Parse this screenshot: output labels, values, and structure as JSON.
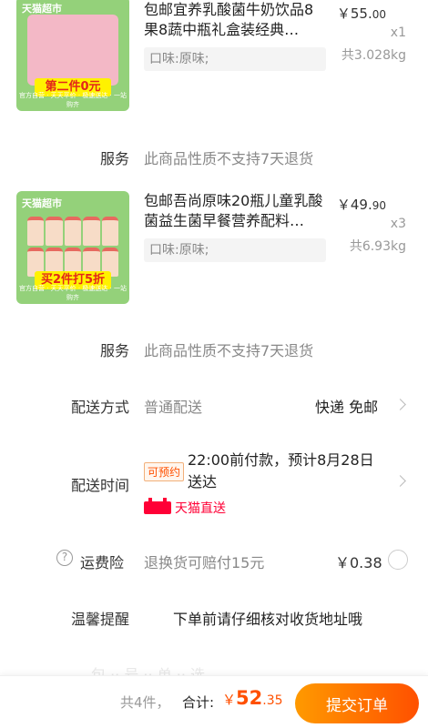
{
  "products": [
    {
      "brand_tag": "天猫超市",
      "promo": "第二件0元",
      "thumb_footer": "官方自营 · 天天平价 · 极速送达 · 一站购齐",
      "title": "包邮宜养乳酸菌牛奶饮品8果8蔬中瓶礼盒装经典…",
      "spec": "口味:原味;",
      "currency": "￥",
      "price_int": "55.",
      "price_dec": "00",
      "qty": "x1",
      "weight": "共3.028kg"
    },
    {
      "brand_tag": "天猫超市",
      "promo": "买2件打5折",
      "thumb_footer": "官方自营 · 天天平价 · 极速送达 · 一站购齐",
      "title": "包邮吾尚原味20瓶儿童乳酸菌益生菌早餐营养配料…",
      "spec": "口味:原味;",
      "currency": "￥",
      "price_int": "49.",
      "price_dec": "90",
      "qty": "x3",
      "weight": "共6.93kg"
    }
  ],
  "service": [
    {
      "label": "服务",
      "value": "此商品性质不支持7天退货"
    },
    {
      "label": "服务",
      "value": "此商品性质不支持7天退货"
    }
  ],
  "delivery": {
    "label": "配送方式",
    "value": "普通配送",
    "right": "快递 免邮"
  },
  "delivery_time": {
    "label": "配送时间",
    "badge": "可预约",
    "text": "22:00前付款，预计8月28日送达",
    "tmall": "天猫直送"
  },
  "insurance": {
    "label": "运费险",
    "help": "?",
    "value": "退换货可赔付15元",
    "price": "￥0.38"
  },
  "notice": {
    "label": "温馨提醒",
    "text": "下单前请仔细核对收货地址哦"
  },
  "faded_text": "包 ·· 号 ·· 单 ·· 选",
  "footer": {
    "count": "共4件，",
    "total_label": "合计:",
    "currency": "￥",
    "total_int": "52",
    "total_dec": ".35",
    "submit": "提交订单"
  },
  "colors": {
    "accent": "#ff5000",
    "tmall_red": "#ff0036",
    "thumb_green": "#94d17a"
  }
}
